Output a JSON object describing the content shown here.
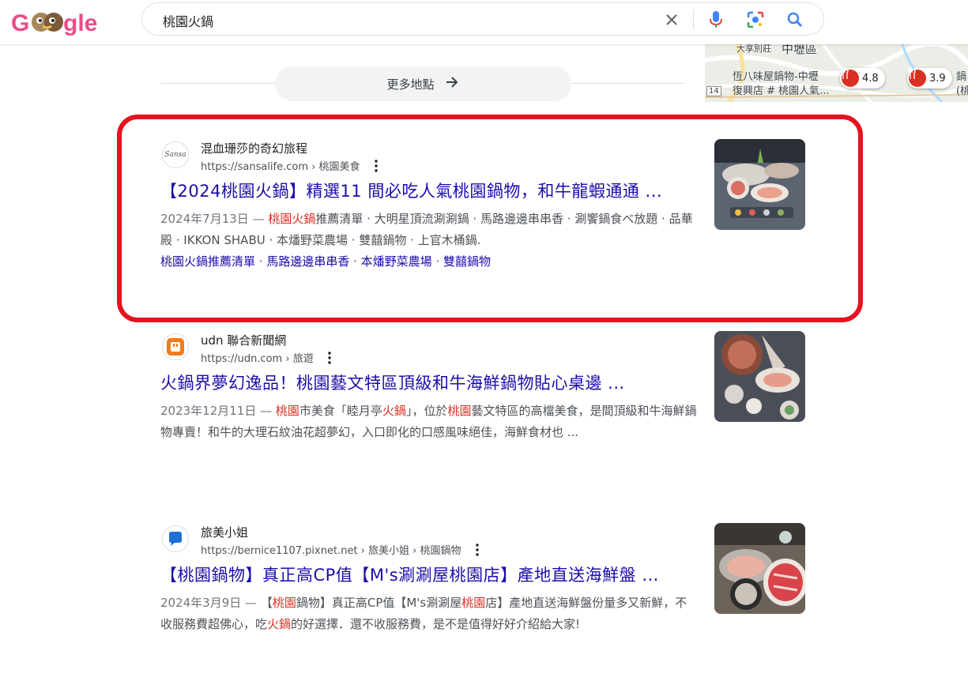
{
  "header": {
    "logo_text": "Google",
    "query": "桃園火鍋"
  },
  "map": {
    "labels": [
      "大享別莊",
      "中壢區",
      "恆八味屋鍋物-中壢",
      "復興店 # 桃園人氣...",
      "14",
      "鍋",
      "(桃"
    ],
    "pins": [
      {
        "rating": "4.8"
      },
      {
        "rating": "3.9"
      }
    ]
  },
  "more_places": {
    "label": "更多地點"
  },
  "results": [
    {
      "site_name": "混血珊莎的奇幻旅程",
      "url": "https://sansalife.com › 桃園美食",
      "favicon_text": "Sansa",
      "title": "【2024桃園火鍋】精選11 間必吃人氣桃園鍋物，和牛龍蝦通通 ...",
      "date": "2024年7月13日 — ",
      "snippet_hl": "桃園火鍋",
      "snippet_rest": "推薦清單 · 大明星頂流涮涮鍋 · 馬路邊邊串串香 · 涮饗鍋食べ放題 · 品華殿 · IKKON SHABU · 本燔野菜農場 · 雙囍鍋物 · 上官木桶鍋.",
      "sitelinks": [
        "桃園火鍋推薦清單",
        "馬路邊邊串串香",
        "本燔野菜農場",
        "雙囍鍋物"
      ]
    },
    {
      "site_name": "udn 聯合新聞網",
      "url": "https://udn.com › 旅遊",
      "title": "火鍋界夢幻逸品！桃園藝文特區頂級和牛海鮮鍋物貼心桌邊 ...",
      "date": "2023年12月11日 — ",
      "p1": "桃園",
      "p2": "市美食「睦月亭",
      "p3": "火鍋",
      "p4": "」，位於",
      "p5": "桃園",
      "p6": "藝文特區的高檔美食，是間頂級和牛海鮮鍋物專賣！和牛的大理石紋油花超夢幻，入口即化的口感風味絕佳，海鮮食材也 ..."
    },
    {
      "site_name": "旅美小姐",
      "url": "https://bernice1107.pixnet.net › 旅美小姐 › 桃園鍋物",
      "title": "【桃園鍋物】真正高CP值【M's涮涮屋桃園店】產地直送海鮮盤 ...",
      "date": "2024年3月9日 — ",
      "p1": "【",
      "p2": "桃園",
      "p3": "鍋物】真正高CP值【M's涮涮屋",
      "p4": "桃園",
      "p5": "店】產地直送海鮮盤份量多又新鮮，不收服務費超佛心，吃",
      "p6": "火鍋",
      "p7": "的好選擇．還不收服務費，是不是值得好好介紹給大家!"
    }
  ],
  "colors": {
    "link": "#1a0dab",
    "highlight_term": "#d93025",
    "annotation_box": "#e3131f"
  }
}
